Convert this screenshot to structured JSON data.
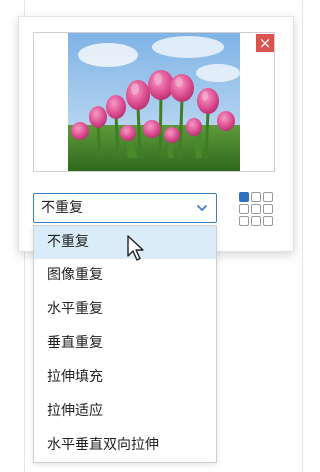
{
  "close_button": {
    "label": "×"
  },
  "select": {
    "value": "不重复"
  },
  "dropdown": {
    "options": [
      "不重复",
      "图像重复",
      "水平重复",
      "垂直重复",
      "拉伸填充",
      "拉伸适应",
      "水平垂直双向拉伸"
    ],
    "selected_index": 0
  },
  "icons": {
    "close": "close-icon",
    "chevron": "chevron-down-icon",
    "grid": "position-grid-icon",
    "cursor": "mouse-pointer-icon"
  },
  "colors": {
    "accent": "#3b7fc4",
    "close_red": "#d9534f",
    "selection_bg": "#d9ecf8",
    "grid_active": "#2e6fbf"
  }
}
